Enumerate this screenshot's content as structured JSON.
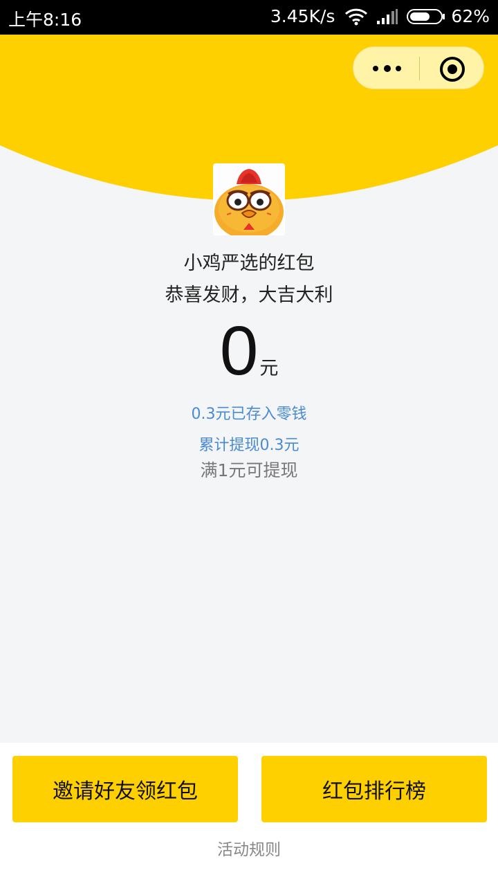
{
  "status_bar": {
    "time": "上午8:16",
    "speed": "3.45K/s",
    "battery": "62%",
    "icons": [
      "wifi-icon",
      "signal-icon",
      "battery-icon"
    ]
  },
  "capsule": {
    "icons": [
      "more-icon",
      "close-target-icon"
    ]
  },
  "colors": {
    "header_yellow": "#ffd000",
    "background": "#f4f5f7",
    "link_blue": "#4a8ad4",
    "button_yellow": "#ffd000"
  },
  "packet": {
    "sender_title": "小鸡严选的红包",
    "greeting": "恭喜发财，大吉大利",
    "amount_value": "0",
    "amount_unit": "元",
    "saved_info": "0.3元已存入零钱",
    "withdrawn_info": "累计提现0.3元",
    "withdraw_tip": "满1元可提现"
  },
  "actions": {
    "invite_label": "邀请好友领红包",
    "ranking_label": "红包排行榜",
    "rules_label": "活动规则"
  }
}
